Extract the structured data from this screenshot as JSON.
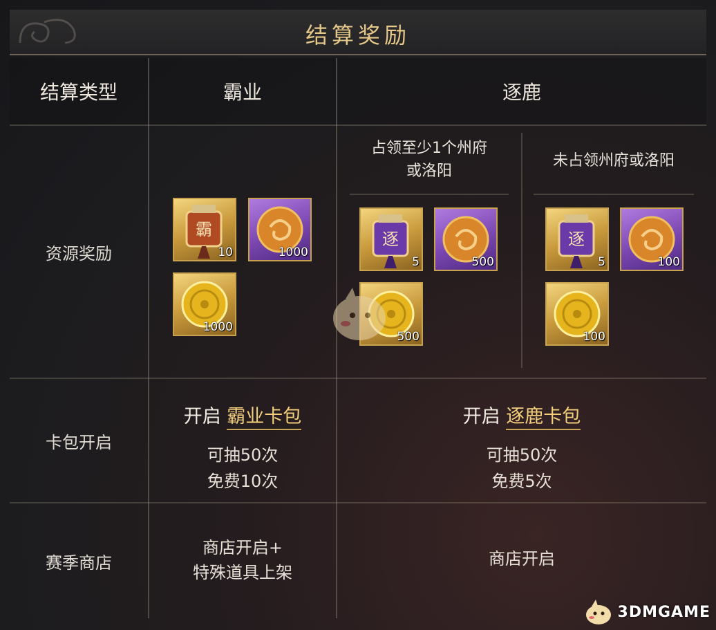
{
  "title": "结算奖励",
  "headers": {
    "type_col": "结算类型",
    "col_baye": "霸业",
    "col_zhulu": "逐鹿"
  },
  "zhulu_sub": {
    "left": "占领至少1个州府\n或洛阳",
    "right": "未占领州府或洛阳"
  },
  "rows": {
    "resource": "资源奖励",
    "cardpack": "卡包开启",
    "shop": "赛季商店"
  },
  "resource_rewards": {
    "baye": [
      {
        "icon": "banner-token-icon",
        "qty": "10"
      },
      {
        "icon": "jade-orb-icon",
        "qty": "1000"
      },
      {
        "icon": "gold-coin-icon",
        "qty": "1000"
      }
    ],
    "zhulu_left": [
      {
        "icon": "banner-token-icon",
        "qty": "5"
      },
      {
        "icon": "jade-orb-icon",
        "qty": "500"
      },
      {
        "icon": "gold-coin-icon",
        "qty": "500"
      }
    ],
    "zhulu_right": [
      {
        "icon": "banner-token-icon",
        "qty": "5"
      },
      {
        "icon": "jade-orb-icon",
        "qty": "100"
      },
      {
        "icon": "gold-coin-icon",
        "qty": "100"
      }
    ]
  },
  "cardpack": {
    "baye": {
      "prefix": "开启",
      "name": "霸业卡包",
      "line1": "可抽50次",
      "line2": "免费10次"
    },
    "zhulu": {
      "prefix": "开启",
      "name": "逐鹿卡包",
      "line1": "可抽50次",
      "line2": "免费5次"
    }
  },
  "shop": {
    "baye": "商店开启+\n特殊道具上架",
    "zhulu": "商店开启"
  },
  "watermark": "3DMGAME",
  "colors": {
    "title_gold": "#e6c989",
    "highlight_gold": "#f3cf7c",
    "item_border": "#c8a24e",
    "purple_bg": "#7a46b0"
  }
}
